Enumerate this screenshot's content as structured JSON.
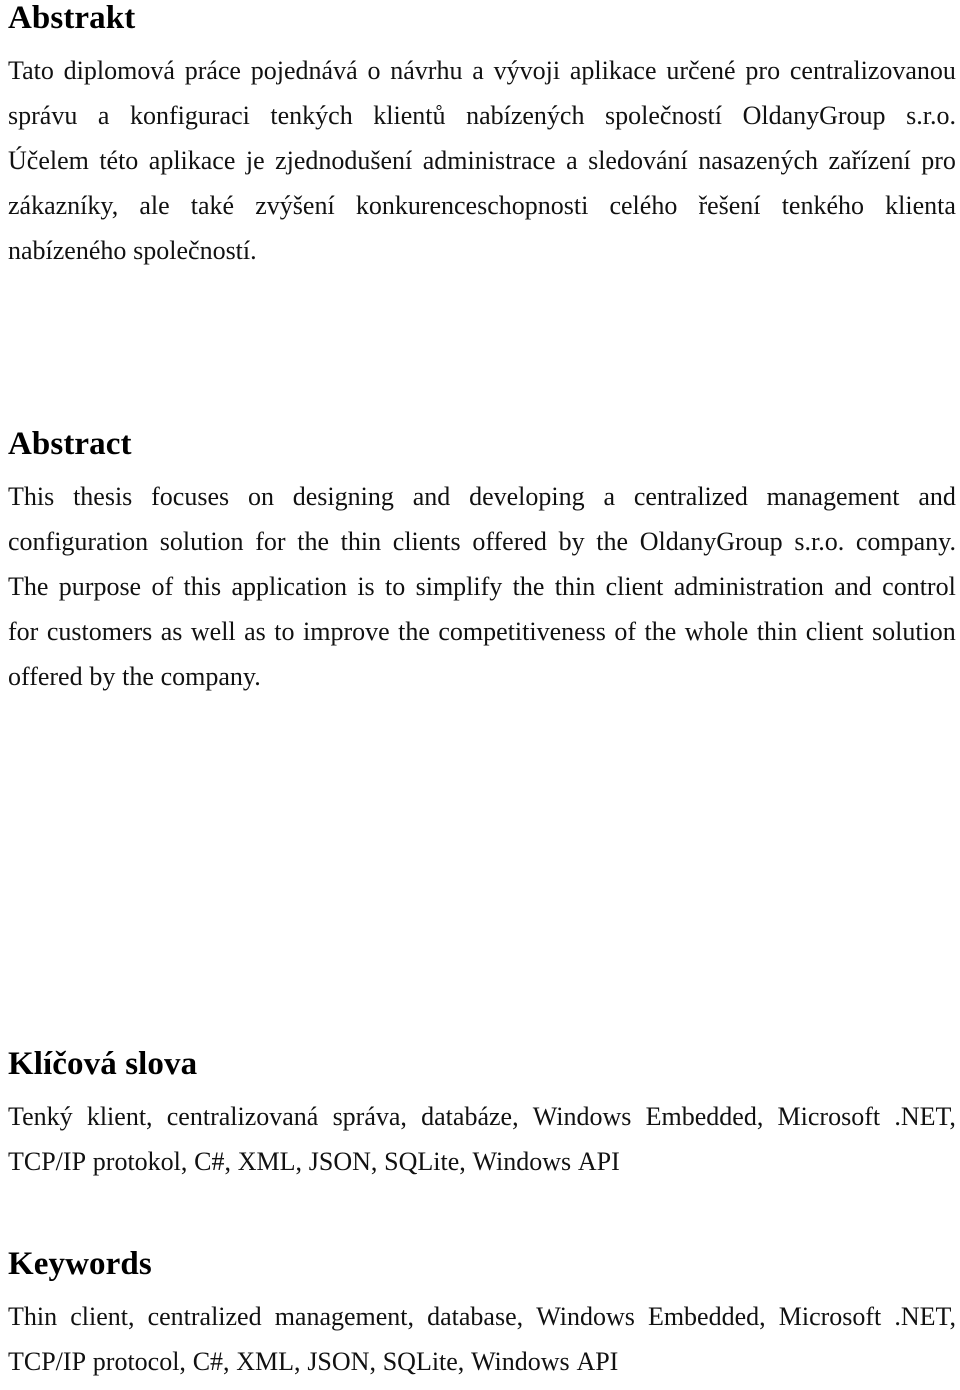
{
  "document": {
    "language_primary": "cs",
    "language_secondary": "en",
    "background_color": "#ffffff",
    "text_color": "#111111"
  },
  "sections": {
    "abstrakt": {
      "heading": "Abstrakt",
      "lines": [
        "Tato diplomová práce pojednává o návrhu a vývoji aplikace určené pro centralizovanou",
        "správu a konfiguraci tenkých klientů nabízených společností OldanyGroup s.r.o.",
        "Účelem této aplikace je zjednodušení administrace a sledování nasazených zařízení pro",
        "zákazníky, ale také zvýšení konkurenceschopnosti celého řešení tenkého klienta",
        "nabízeného společností."
      ],
      "full_text": "Tato diplomová práce pojednává o návrhu a vývoji aplikace určené pro centralizovanou správu a konfiguraci tenkých klientů nabízených společností OldanyGroup s.r.o. Účelem této aplikace je zjednodušení administrace a sledování nasazených zařízení pro zákazníky, ale také zvýšení konkurenceschopnosti celého řešení tenkého klienta nabízeného společností."
    },
    "abstract": {
      "heading": "Abstract",
      "lines": [
        "This thesis focuses on designing and developing a centralized management and",
        "configuration solution for the thin clients offered by the OldanyGroup s.r.o. company.",
        "The purpose of this application is to simplify the thin client administration and control",
        "for customers as well as to improve the competitiveness of the whole thin client solution",
        "offered by the company."
      ],
      "full_text": "This thesis focuses on designing and developing a centralized management and configuration solution for the thin clients offered by the OldanyGroup s.r.o. company. The purpose of this application is to simplify the thin client administration and control for customers as well as to improve the competitiveness of the whole thin client solution offered by the company."
    },
    "klicova_slova": {
      "heading": "Klíčová slova",
      "lines": [
        "Tenký klient, centralizovaná správa, databáze, Windows Embedded, Microsoft .NET,",
        "TCP/IP protokol, C#, XML, JSON, SQLite, Windows API"
      ],
      "terms": [
        "Tenký klient",
        "centralizovaná správa",
        "databáze",
        "Windows Embedded",
        "Microsoft .NET",
        "TCP/IP protokol",
        "C#",
        "XML",
        "JSON",
        "SQLite",
        "Windows API"
      ]
    },
    "keywords": {
      "heading": "Keywords",
      "lines": [
        "Thin client, centralized management, database, Windows Embedded, Microsoft .NET,",
        "TCP/IP protocol, C#, XML, JSON, SQLite, Windows API"
      ],
      "terms": [
        "Thin client",
        "centralized management",
        "database",
        "Windows Embedded",
        "Microsoft .NET",
        "TCP/IP protocol",
        "C#",
        "XML",
        "JSON",
        "SQLite",
        "Windows API"
      ]
    }
  }
}
